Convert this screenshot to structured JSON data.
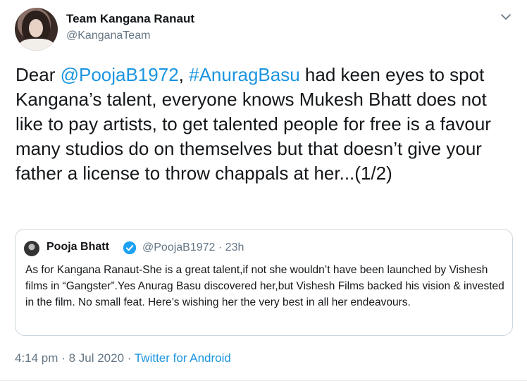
{
  "author": {
    "name": "Team Kangana Ranaut",
    "handle": "@KanganaTeam"
  },
  "tweet": {
    "parts": [
      "Dear ",
      "@PoojaB1972",
      ", ",
      "#AnuragBasu",
      " had keen eyes to spot Kangana’s talent, everyone knows Mukesh Bhatt does not like to pay artists, to get talented people for free is a favour many studios do on themselves but that doesn’t give your father a license to throw chappals at her...(1/2)"
    ]
  },
  "quoted": {
    "name": "Pooja Bhatt",
    "handle": "@PoojaB1972",
    "separator": "·",
    "time": "23h",
    "text": "As for Kangana Ranaut-She is a great talent,if not she wouldn’t have been launched by Vishesh films in “Gangster”.Yes Anurag Basu discovered her,but Vishesh Films backed his vision & invested in the film. No small feat. Here’s wishing her the very best in all her endeavours."
  },
  "meta": {
    "time": "4:14 pm",
    "separator1": "·",
    "date": "8 Jul 2020",
    "separator2": "·",
    "source": "Twitter for Android"
  },
  "colors": {
    "link": "#1b95e0",
    "secondary_text": "#657786",
    "border": "#ccd6dd"
  },
  "icons": {
    "menu": "chevron-down-icon",
    "verified": "verified-badge-icon"
  }
}
